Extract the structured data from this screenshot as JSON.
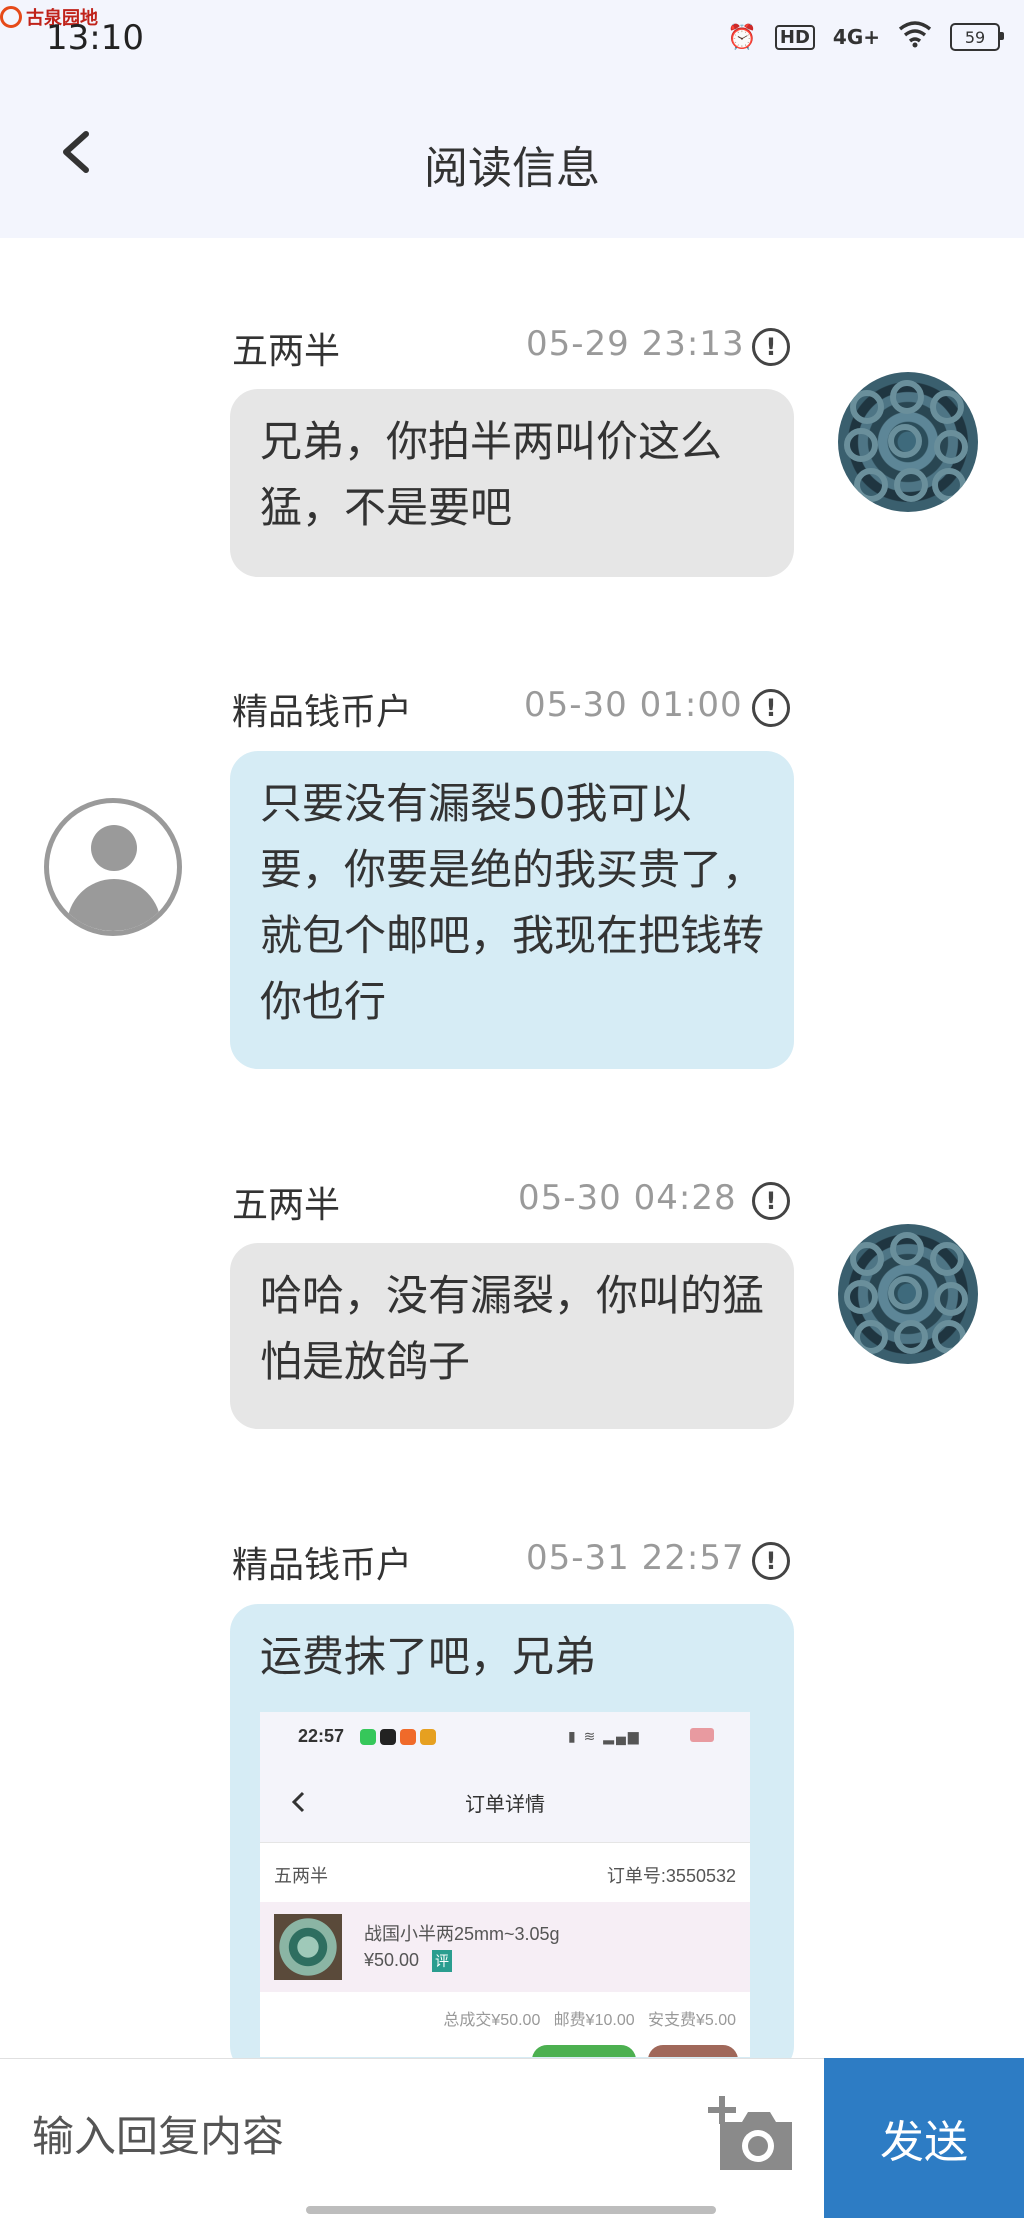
{
  "status_bar": {
    "time": "13:10",
    "brand": "古泉园地",
    "hd": "HD",
    "network": "4G+",
    "battery": "59"
  },
  "header": {
    "title": "阅读信息"
  },
  "messages": [
    {
      "sender": "五两半",
      "time": "05-29 23:13",
      "text": "兄弟，你拍半两叫价这么猛，不是要吧",
      "side": "right"
    },
    {
      "sender": "精品钱币户",
      "time": "05-30 01:00",
      "text": "只要没有漏裂50我可以要，你要是绝的我买贵了，就包个邮吧，我现在把钱转你也行",
      "side": "left"
    },
    {
      "sender": "五两半",
      "time": "05-30 04:28",
      "text": "哈哈，没有漏裂，你叫的猛怕是放鸽子",
      "side": "right"
    },
    {
      "sender": "精品钱币户",
      "time": "05-31 22:57",
      "text": "运费抹了吧，兄弟",
      "side": "left"
    }
  ],
  "embedded_screenshot": {
    "time": "22:57",
    "title": "订单详情",
    "seller": "五两半",
    "order_no": "订单号:3550532",
    "item_name": "战国小半两25mm~3.05g",
    "price": "¥50.00",
    "tag": "评",
    "totals": "总成交¥50.00   邮费¥10.00   安支费¥5.00"
  },
  "input": {
    "placeholder": "输入回复内容",
    "send_label": "发送"
  },
  "colors": {
    "accent": "#2d7cc4",
    "header_bg": "#f3f5fd",
    "bubble_grey": "#e6e6e6",
    "bubble_blue": "#d6ecf5"
  }
}
